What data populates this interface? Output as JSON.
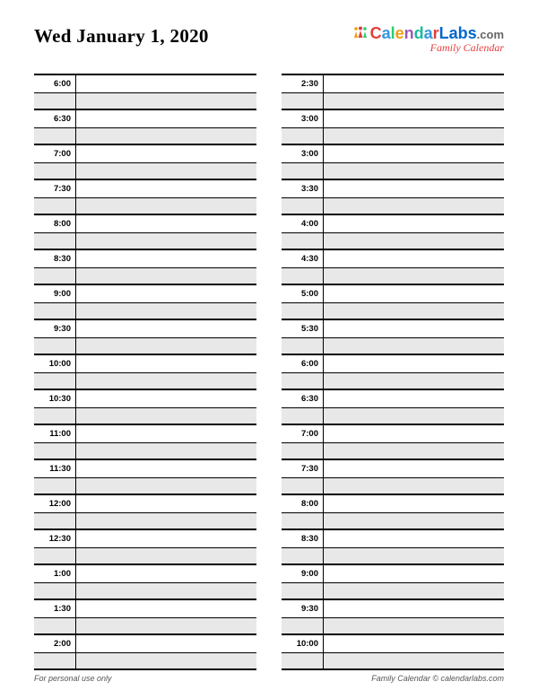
{
  "header": {
    "date_title": "Wed January 1, 2020",
    "logo": {
      "word": "CalendarLabs",
      "suffix": ".com",
      "tagline": "Family Calendar"
    }
  },
  "planner": {
    "left_times": [
      "6:00",
      "",
      "6:30",
      "",
      "7:00",
      "",
      "7:30",
      "",
      "8:00",
      "",
      "8:30",
      "",
      "9:00",
      "",
      "9:30",
      "",
      "10:00",
      "",
      "10:30",
      "",
      "11:00",
      "",
      "11:30",
      "",
      "12:00",
      "",
      "12:30",
      "",
      "1:00",
      "",
      "1:30",
      "",
      "2:00",
      ""
    ],
    "right_times": [
      "2:30",
      "",
      "3:00",
      "",
      "3:00",
      "",
      "3:30",
      "",
      "4:00",
      "",
      "4:30",
      "",
      "5:00",
      "",
      "5:30",
      "",
      "6:00",
      "",
      "6:30",
      "",
      "7:00",
      "",
      "7:30",
      "",
      "8:00",
      "",
      "8:30",
      "",
      "9:00",
      "",
      "9:30",
      "",
      "10:00",
      ""
    ]
  },
  "footer": {
    "left": "For personal use only",
    "right": "Family Calendar  © calendarlabs.com"
  }
}
